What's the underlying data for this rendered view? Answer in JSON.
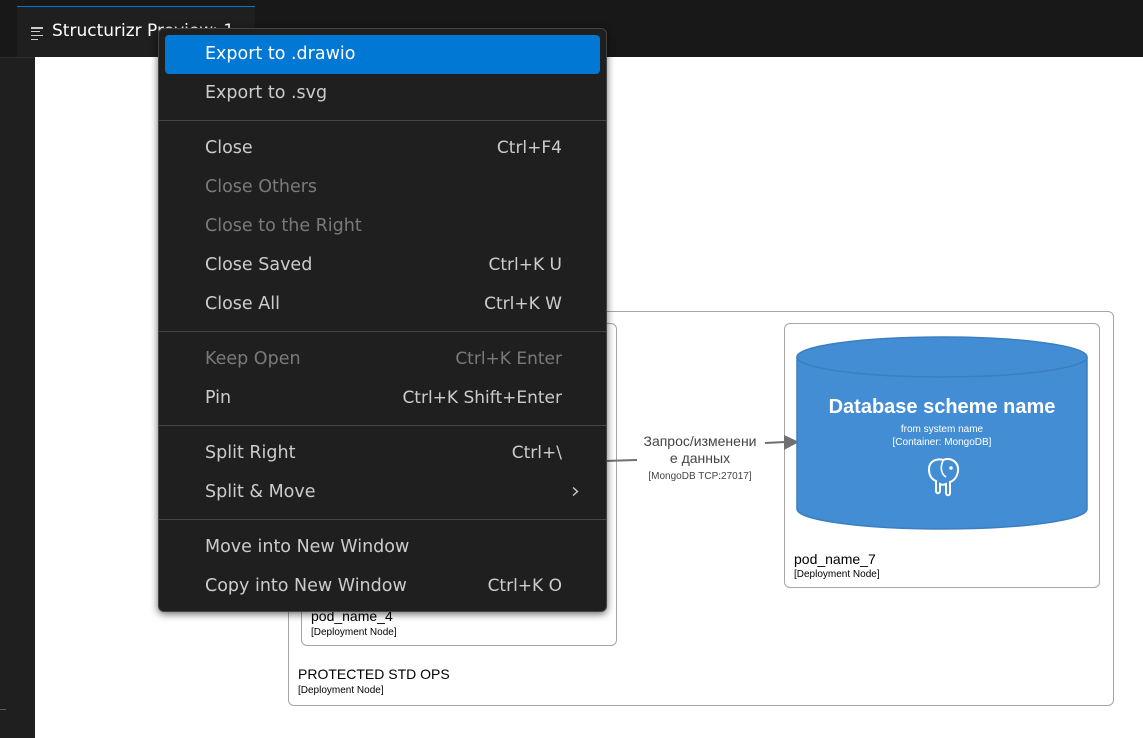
{
  "tab": {
    "title": "Structurizr Preview: 1",
    "icon": "preview-lines-icon"
  },
  "colors": {
    "accent": "#0078d4",
    "database": "#438dd5",
    "menu_bg": "#1f1f1f"
  },
  "menu": {
    "items": [
      {
        "label": "Export to .drawio",
        "shortcut": "",
        "state": "selected"
      },
      {
        "label": "Export to .svg",
        "shortcut": "",
        "state": "enabled"
      },
      {
        "label": "Close",
        "shortcut": "Ctrl+F4",
        "state": "enabled"
      },
      {
        "label": "Close Others",
        "shortcut": "",
        "state": "disabled"
      },
      {
        "label": "Close to the Right",
        "shortcut": "",
        "state": "disabled"
      },
      {
        "label": "Close Saved",
        "shortcut": "Ctrl+K U",
        "state": "enabled"
      },
      {
        "label": "Close All",
        "shortcut": "Ctrl+K W",
        "state": "enabled"
      },
      {
        "label": "Keep Open",
        "shortcut": "Ctrl+K Enter",
        "state": "disabled"
      },
      {
        "label": "Pin",
        "shortcut": "Ctrl+K Shift+Enter",
        "state": "enabled"
      },
      {
        "label": "Split Right",
        "shortcut": "Ctrl+\\",
        "state": "enabled"
      },
      {
        "label": "Split & Move",
        "shortcut": "",
        "state": "enabled",
        "submenu": true
      },
      {
        "label": "Move into New Window",
        "shortcut": "",
        "state": "enabled"
      },
      {
        "label": "Copy into New Window",
        "shortcut": "Ctrl+K O",
        "state": "enabled"
      }
    ]
  },
  "diagram": {
    "outer_node": {
      "name": "PROTECTED STD OPS",
      "type": "[Deployment Node]"
    },
    "left_node": {
      "name": "pod_name_4",
      "type": "[Deployment Node]"
    },
    "right_node": {
      "name": "pod_name_7",
      "type": "[Deployment Node]"
    },
    "relationship": {
      "label_line1": "Запрос/изменени",
      "label_line2": "е данных",
      "technology": "[MongoDB TCP:27017]"
    },
    "database": {
      "title": "Database scheme name",
      "description": "from system name",
      "type": "[Container: MongoDB]",
      "icon": "mongodb-elephant-icon"
    }
  }
}
